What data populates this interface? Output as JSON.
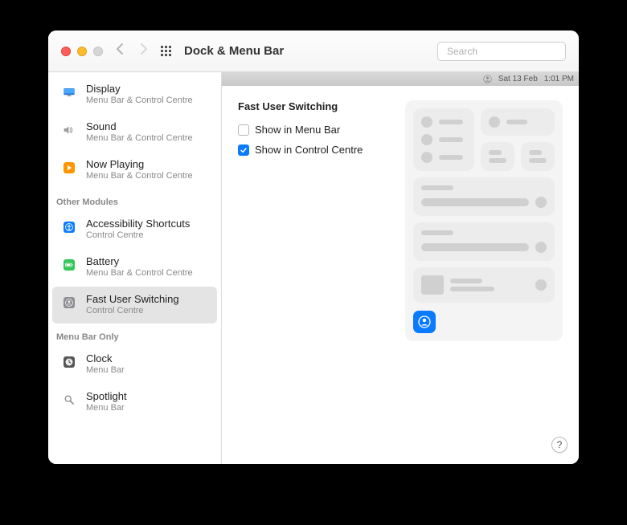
{
  "window": {
    "title": "Dock & Menu Bar",
    "search_placeholder": "Search"
  },
  "menubar": {
    "date": "Sat 13 Feb",
    "time": "1:01 PM"
  },
  "sidebar": {
    "groups": [
      {
        "label": null,
        "items": [
          {
            "title": "Display",
            "sub": "Menu Bar & Control Centre",
            "icon": "display",
            "selected": false
          },
          {
            "title": "Sound",
            "sub": "Menu Bar & Control Centre",
            "icon": "sound",
            "selected": false
          },
          {
            "title": "Now Playing",
            "sub": "Menu Bar & Control Centre",
            "icon": "play",
            "selected": false
          }
        ]
      },
      {
        "label": "Other Modules",
        "items": [
          {
            "title": "Accessibility Shortcuts",
            "sub": "Control Centre",
            "icon": "accessibility",
            "selected": false
          },
          {
            "title": "Battery",
            "sub": "Menu Bar & Control Centre",
            "icon": "battery",
            "selected": false
          },
          {
            "title": "Fast User Switching",
            "sub": "Control Centre",
            "icon": "users",
            "selected": true
          }
        ]
      },
      {
        "label": "Menu Bar Only",
        "items": [
          {
            "title": "Clock",
            "sub": "Menu Bar",
            "icon": "clock",
            "selected": false
          },
          {
            "title": "Spotlight",
            "sub": "Menu Bar",
            "icon": "spotlight",
            "selected": false
          }
        ]
      }
    ]
  },
  "main": {
    "heading": "Fast User Switching",
    "options": [
      {
        "label": "Show in Menu Bar",
        "checked": false
      },
      {
        "label": "Show in Control Centre",
        "checked": true
      }
    ]
  },
  "help": "?"
}
